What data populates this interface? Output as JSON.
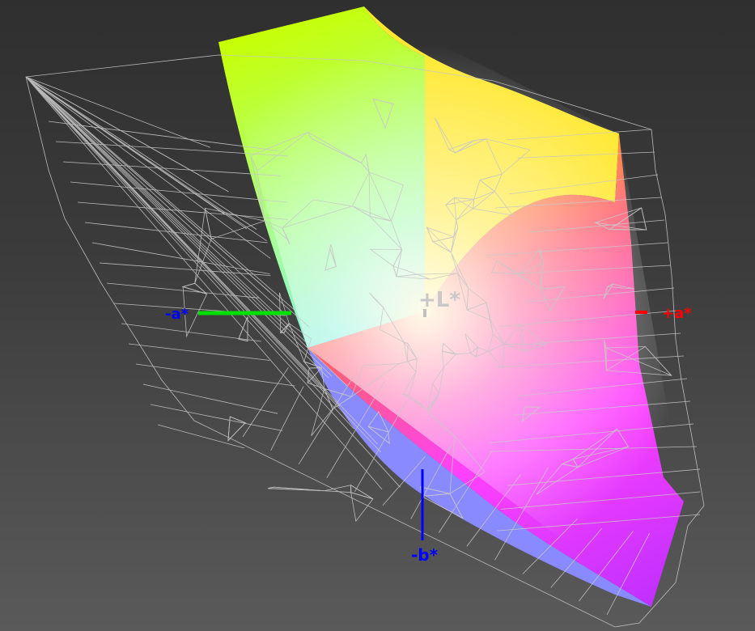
{
  "axes": {
    "plus_L": "+L*",
    "plus_a": "+a*",
    "minus_a": "-a*",
    "minus_b": "-b*"
  },
  "colors": {
    "background_top": "#2f2f2f",
    "background_bottom": "#5a5a5a",
    "wireframe": "#c8c8c8",
    "axis_plus_a": "#ff0000",
    "axis_minus_a": "#00e000",
    "axis_minus_b": "#0000ff",
    "axis_plus_L": "#c0c0c0"
  }
}
